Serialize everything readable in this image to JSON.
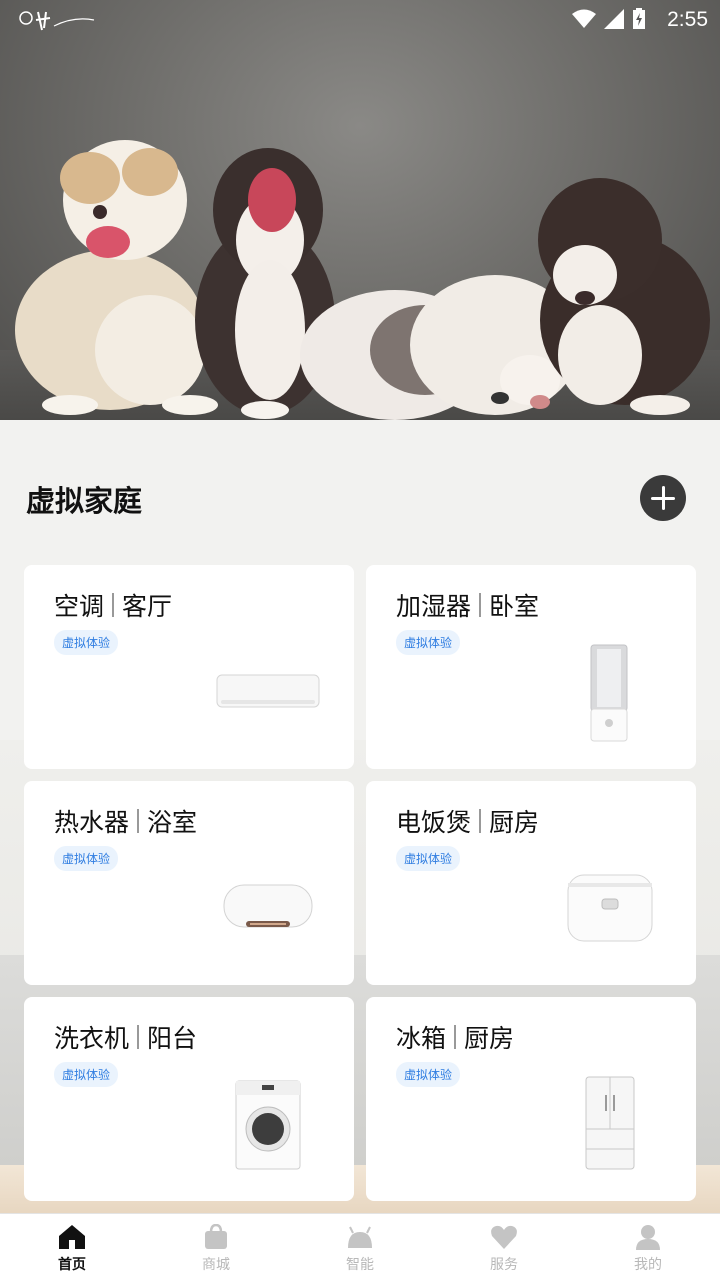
{
  "status_bar": {
    "time": "2:55"
  },
  "section": {
    "title": "虚拟家庭"
  },
  "cards": [
    {
      "device": "空调",
      "room": "客厅",
      "badge": "虚拟体验",
      "icon": "air-conditioner-image"
    },
    {
      "device": "加湿器",
      "room": "卧室",
      "badge": "虚拟体验",
      "icon": "humidifier-image"
    },
    {
      "device": "热水器",
      "room": "浴室",
      "badge": "虚拟体验",
      "icon": "water-heater-image"
    },
    {
      "device": "电饭煲",
      "room": "厨房",
      "badge": "虚拟体验",
      "icon": "rice-cooker-image"
    },
    {
      "device": "洗衣机",
      "room": "阳台",
      "badge": "虚拟体验",
      "icon": "washing-machine-image"
    },
    {
      "device": "冰箱",
      "room": "厨房",
      "badge": "虚拟体验",
      "icon": "refrigerator-image"
    }
  ],
  "bottom_nav": {
    "items": [
      {
        "label": "首页",
        "icon": "home-icon",
        "active": true
      },
      {
        "label": "商城",
        "icon": "shopping-bag-icon",
        "active": false
      },
      {
        "label": "智能",
        "icon": "android-icon",
        "active": false
      },
      {
        "label": "服务",
        "icon": "heart-icon",
        "active": false
      },
      {
        "label": "我的",
        "icon": "person-icon",
        "active": false
      }
    ]
  },
  "colors": {
    "accent_badge": "#2f7de1",
    "badge_bg": "#eaf3fd",
    "active_nav": "#111111",
    "inactive_nav": "#b8b8b8"
  }
}
